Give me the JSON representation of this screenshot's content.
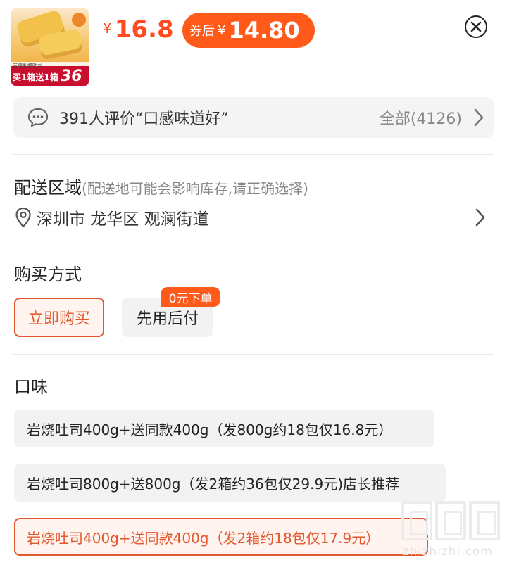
{
  "product": {
    "thumbnail": {
      "label_small": "岩烧乳酪吐司",
      "label_main": "买1箱送1箱",
      "label_number": "36"
    },
    "price_currency": "¥",
    "price": "16.8",
    "coupon_label": "券后",
    "coupon_currency": "¥",
    "coupon_price": "14.80"
  },
  "review": {
    "text": "391人评价“口感味道好”",
    "all_label": "全部(4126)"
  },
  "delivery": {
    "title": "配送区域",
    "hint": "(配送地可能会影响库存,请正确选择)",
    "address": "深圳市 龙华区 观澜街道"
  },
  "purchase": {
    "title": "购买方式",
    "buy_now": "立即购买",
    "pay_later": "先用后付",
    "badge": "0元下单"
  },
  "flavor": {
    "title": "口味",
    "options": [
      "岩烧吐司400g+送同款400g（发800g约18包仅16.8元）",
      "岩烧吐司800g+送800g（发2箱约36包仅29.9元)店长推荐",
      "岩烧吐司400g+送同款400g（发2箱约18包仅17.9元）"
    ],
    "selected_index": 2
  },
  "watermark": {
    "text": "zhizhizhi.com"
  },
  "colors": {
    "accent": "#ff5a1a",
    "accent_border": "#e3572c",
    "selected_bg": "#fff4f0",
    "chip_bg": "#f2f2f2"
  }
}
